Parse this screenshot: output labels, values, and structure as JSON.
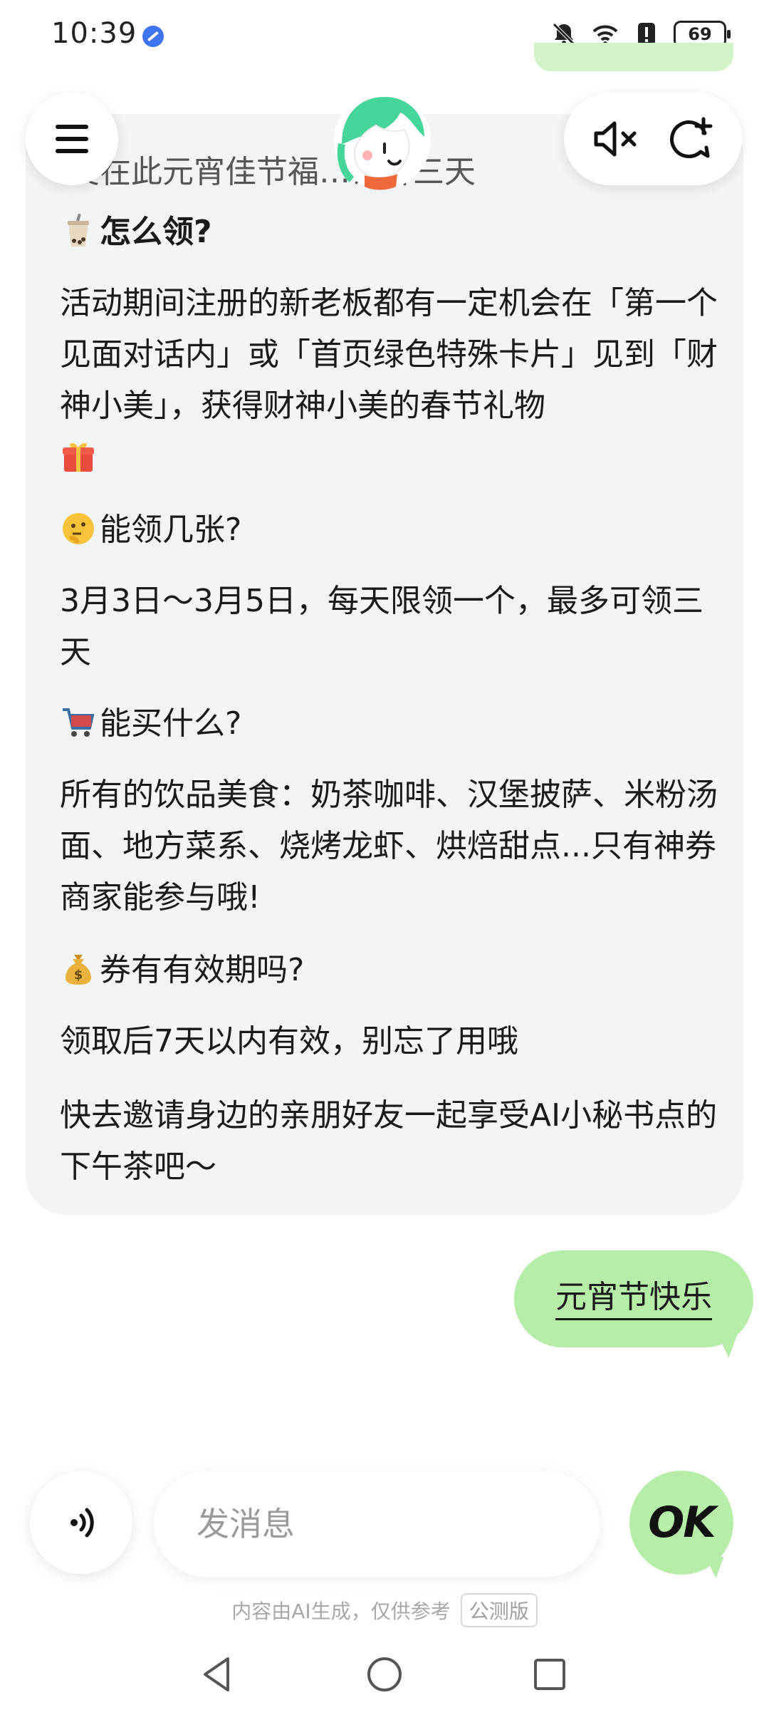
{
  "status_bar": {
    "time": "10:39",
    "battery": "69",
    "icons": [
      "notifications-off-icon",
      "wifi-icon",
      "alert-icon",
      "battery-icon"
    ]
  },
  "header": {
    "truncated_text": "美在此元宵佳节福…请客三天",
    "icons": [
      "menu-icon",
      "mute-icon",
      "new-chat-icon"
    ]
  },
  "message": {
    "sections": [
      {
        "emoji": "bubble-tea-emoji",
        "heading": "怎么领?",
        "body": "活动期间注册的新老板都有一定机会在「第一个见面对话内」或「首页绿色特殊卡片」见到「财神小美」，获得财神小美的春节礼物"
      },
      {
        "emoji": "thinking-emoji",
        "heading": "能领几张?",
        "body": "3月3日～3月5日，每天限领一个，最多可领三天"
      },
      {
        "emoji": "cart-emoji",
        "heading": "能买什么?",
        "body": "所有的饮品美食：奶茶咖啡、汉堡披萨、米粉汤面、地方菜系、烧烤龙虾、烘焙甜点...只有神券商家能参与哦!"
      },
      {
        "emoji": "money-bag-emoji",
        "heading": "券有有效期吗?",
        "body": "领取后7天以内有效，别忘了用哦"
      }
    ],
    "closing": "快去邀请身边的亲朋好友一起享受AI小秘书点的下午茶吧～"
  },
  "user_message": "元宵节快乐",
  "input": {
    "placeholder": "发消息",
    "send_label": "OK"
  },
  "footer": {
    "disclaimer": "内容由AI生成，仅供参考",
    "beta_tag": "公测版"
  },
  "colors": {
    "accent_green": "#b6eda8",
    "card_bg": "#f3f4f6"
  }
}
